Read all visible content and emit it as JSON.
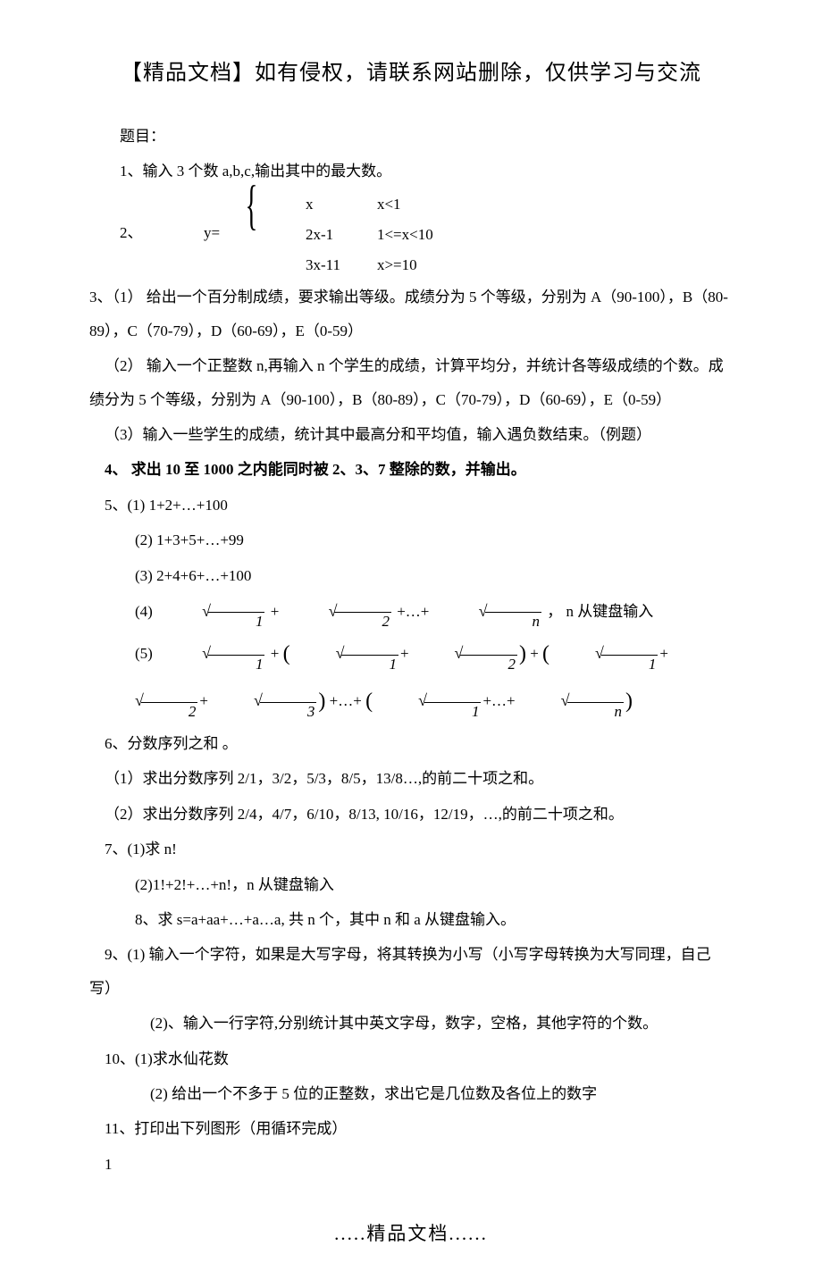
{
  "header": "【精品文档】如有侵权，请联系网站删除，仅供学习与交流",
  "title_label": "题目：",
  "q1": "1、输入 3 个数 a,b,c,输出其中的最大数。",
  "q2_label": "2、",
  "q2_yeq": "y=",
  "q2_cases": [
    {
      "expr": "x",
      "cond": "x<1"
    },
    {
      "expr": "2x-1",
      "cond": "1<=x<10"
    },
    {
      "expr": "3x-11",
      "cond": "x>=10"
    }
  ],
  "q3_1": "3、（1） 给出一个百分制成绩，要求输出等级。成绩分为 5 个等级，分别为 A（90-100），B（80-89），C（70-79），D（60-69），E（0-59）",
  "q3_2": "（2） 输入一个正整数 n,再输入 n 个学生的成绩，计算平均分，并统计各等级成绩的个数。成绩分为 5 个等级，分别为 A（90-100），B（80-89），C（70-79），D（60-69），E（0-59）",
  "q3_3": "（3）输入一些学生的成绩，统计其中最高分和平均值，输入遇负数结束。（例题）",
  "q4": "4、 求出 10 至 1000 之内能同时被 2、3、7 整除的数，并输出。",
  "q5_label": "5、(1) 1+2+…+100",
  "q5_2": "(2) 1+3+5+…+99",
  "q5_3": "(3) 2+4+6+…+100",
  "q5_4_prefix": "(4)  ",
  "q5_4_suffix": " ，  n 从键盘输入",
  "q5_5_prefix": "(5)  ",
  "q6_label": "6、分数序列之和 。",
  "q6_1": "（1）求出分数序列 2/1，3/2，5/3，8/5，13/8…,的前二十项之和。",
  "q6_2": "（2）求出分数序列 2/4，4/7，6/10，8/13, 10/16，12/19，…,的前二十项之和。",
  "q7_1": "7、(1)求 n!",
  "q7_2": "(2)1!+2!+…+n!，n 从键盘输入",
  "q8": "8、求 s=a+aa+…+a…a,  共 n 个，其中 n 和 a 从键盘输入。",
  "q9_1": "9、(1) 输入一个字符，如果是大写字母，将其转换为小写（小写字母转换为大写同理，自己写）",
  "q9_2": "(2)、输入一行字符,分别统计其中英文字母，数字，空格，其他字符的个数。",
  "q10_1": "10、(1)求水仙花数",
  "q10_2": "(2) 给出一个不多于 5 位的正整数，求出它是几位数及各位上的数字",
  "q11": "11、打印出下列图形（用循环完成）",
  "pattern_1": "1",
  "footer": ".....精品文档......"
}
